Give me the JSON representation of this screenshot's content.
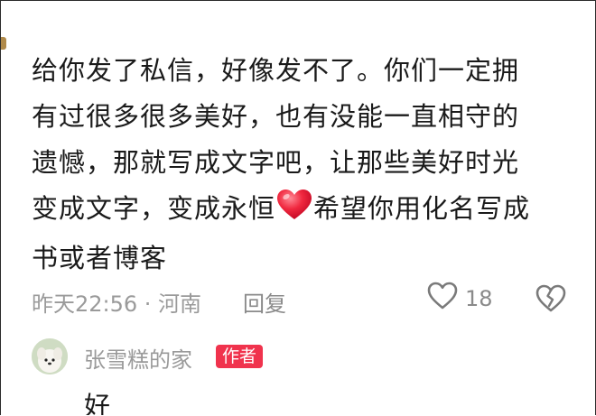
{
  "comment": {
    "lines": [
      "给你发了私信，好像发不了。你们一定拥",
      "有过很多很多美好，也有没能一直相守的",
      "遗憾，那就写成文字吧，让那些美好时光",
      "变成文字，变成永恒",
      "希望你用化名写成",
      "书或者博客"
    ],
    "time_location": "昨天22:56 · 河南",
    "reply_label": "回复",
    "like_count": "18"
  },
  "reply": {
    "author": "张雪糕的家",
    "badge": "作者",
    "text": "好"
  },
  "icons": {
    "heart_emoji": "red-heart",
    "like": "heart-outline",
    "dislike": "broken-heart-outline"
  },
  "colors": {
    "badge": "#f0334d",
    "meta_text": "#9a9a9a",
    "body_text": "#1a1a1a"
  }
}
